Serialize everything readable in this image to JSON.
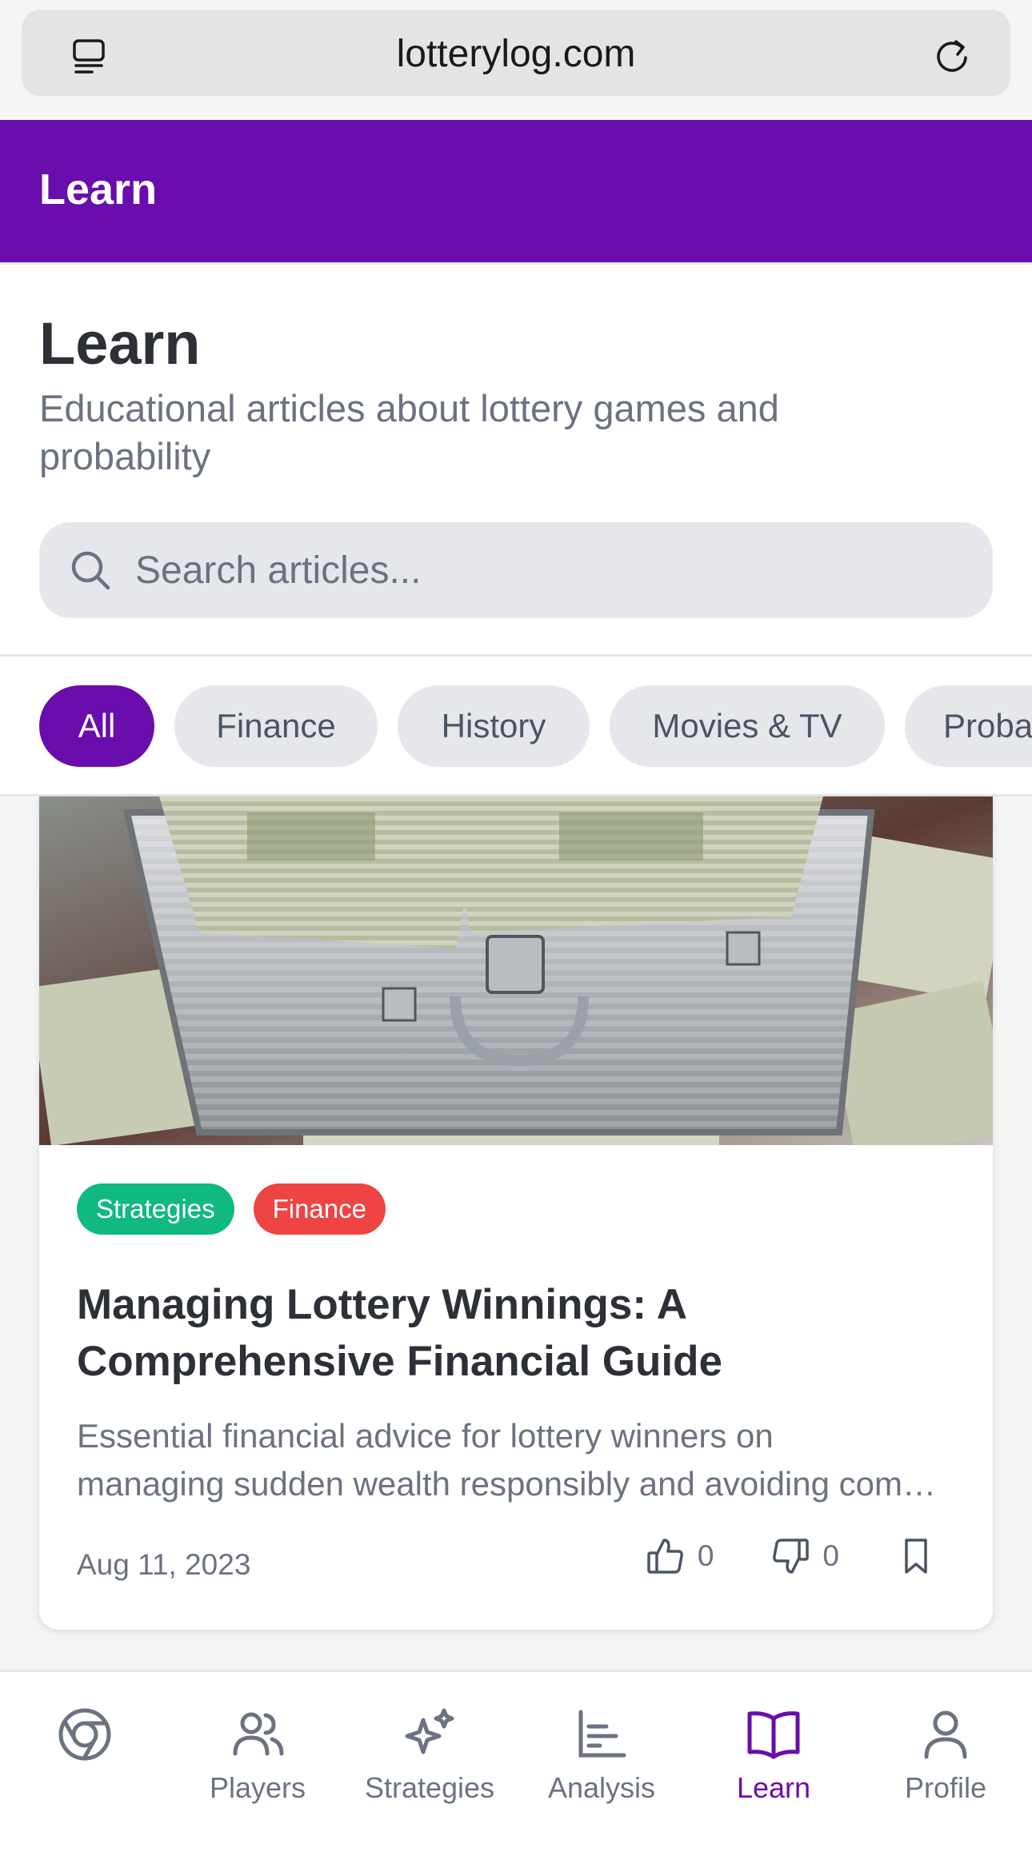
{
  "browser": {
    "url": "lotterylog.com"
  },
  "header": {
    "title": "Learn"
  },
  "intro": {
    "title": "Learn",
    "subtitle": "Educational articles about lottery games and probability",
    "search_placeholder": "Search articles..."
  },
  "categories": [
    {
      "label": "All",
      "active": true
    },
    {
      "label": "Finance",
      "active": false
    },
    {
      "label": "History",
      "active": false
    },
    {
      "label": "Movies & TV",
      "active": false
    },
    {
      "label": "Probability",
      "active": false
    }
  ],
  "article": {
    "image_description": "open metal briefcase filled with stacks of US dollar bills",
    "tags": [
      {
        "label": "Strategies",
        "color": "#10b981"
      },
      {
        "label": "Finance",
        "color": "#ef4444"
      }
    ],
    "title_line1": "Managing Lottery Winnings: A",
    "title_line2": "Comprehensive Financial Guide",
    "excerpt_line1": "Essential financial advice for lottery winners on",
    "excerpt_line2": "managing sudden wealth responsibly and avoiding common pitfalls.",
    "date": "Aug 11, 2023",
    "likes": "0",
    "dislikes": "0"
  },
  "nav": {
    "items": [
      {
        "label": "",
        "icon": "logo-icon"
      },
      {
        "label": "Players",
        "icon": "users-icon"
      },
      {
        "label": "Strategies",
        "icon": "sparkles-icon"
      },
      {
        "label": "Analysis",
        "icon": "bar-chart-icon"
      },
      {
        "label": "Learn",
        "icon": "book-icon",
        "active": true
      },
      {
        "label": "Profile",
        "icon": "user-icon"
      }
    ]
  },
  "colors": {
    "brand": "#6a0dad",
    "strategies_tag": "#10b981",
    "finance_tag": "#ef4444"
  }
}
